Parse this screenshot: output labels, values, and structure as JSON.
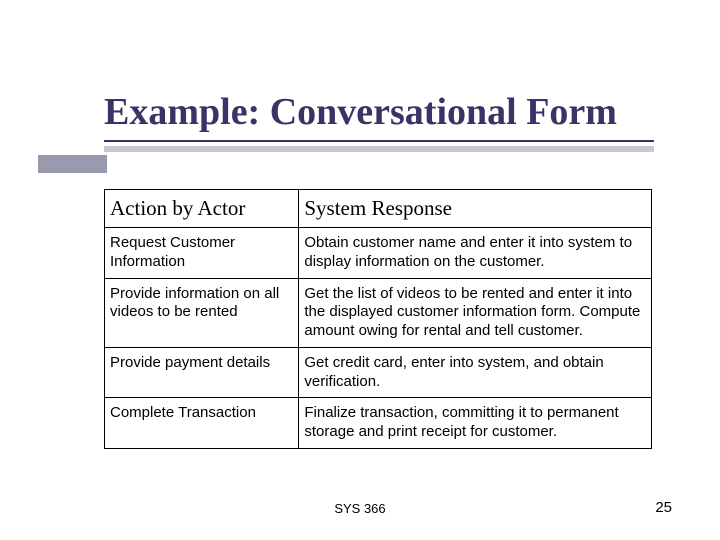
{
  "title": "Example: Conversational Form",
  "table": {
    "headers": {
      "actor": "Action by Actor",
      "system": "System Response"
    },
    "rows": [
      {
        "actor": "Request Customer Information",
        "system": "Obtain customer name and enter it into system to display information on the customer."
      },
      {
        "actor": "Provide information on all videos to be rented",
        "system": "Get the list of videos to be rented and enter it into the displayed customer information form. Compute amount owing for rental and tell customer."
      },
      {
        "actor": "Provide payment details",
        "system": "Get credit card, enter into system, and obtain verification."
      },
      {
        "actor": "Complete Transaction",
        "system": "Finalize transaction, committing it to permanent storage and print receipt for customer."
      }
    ]
  },
  "footer": {
    "course": "SYS 366",
    "page": "25"
  }
}
